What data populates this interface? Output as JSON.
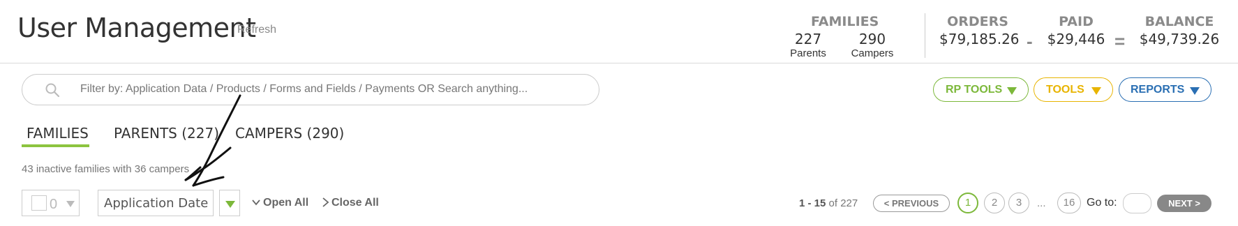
{
  "header": {
    "title": "User Management",
    "refresh_label": "Refresh"
  },
  "stats": {
    "families": {
      "heading": "FAMILIES",
      "parents_count": "227",
      "parents_label": "Parents",
      "campers_count": "290",
      "campers_label": "Campers"
    },
    "orders": {
      "heading": "ORDERS",
      "value": "$79,185.26"
    },
    "minus_sign": "-",
    "paid": {
      "heading": "PAID",
      "value": "$29,446"
    },
    "equals_sign": "=",
    "balance": {
      "heading": "BALANCE",
      "value": "$49,739.26"
    }
  },
  "search": {
    "placeholder": "Filter by: Application Data / Products / Forms and Fields / Payments OR Search anything..."
  },
  "toolbar": {
    "rp_tools_label": "RP TOOLS",
    "tools_label": "TOOLS",
    "reports_label": "REPORTS"
  },
  "tabs": [
    {
      "label": "FAMILIES",
      "active": true
    },
    {
      "label": "PARENTS (227)",
      "active": false
    },
    {
      "label": "CAMPERS (290)",
      "active": false
    }
  ],
  "inactive_summary": "43 inactive families with 36 campers",
  "list_controls": {
    "selected_count": "0",
    "sort_placeholder": "Application Date",
    "open_all_label": "Open All",
    "close_all_label": "Close All"
  },
  "pagination": {
    "range": "1 - 15",
    "of_label": "of",
    "total": "227",
    "previous_label": "< PREVIOUS",
    "pages": [
      "1",
      "2",
      "3",
      "16"
    ],
    "ellipsis": "...",
    "goto_label": "Go to:",
    "next_label": "NEXT >"
  },
  "colors": {
    "green": "#7cb83a",
    "yellow": "#e8b400",
    "blue": "#2a6fb3",
    "tab_underline": "#8cc43f"
  }
}
